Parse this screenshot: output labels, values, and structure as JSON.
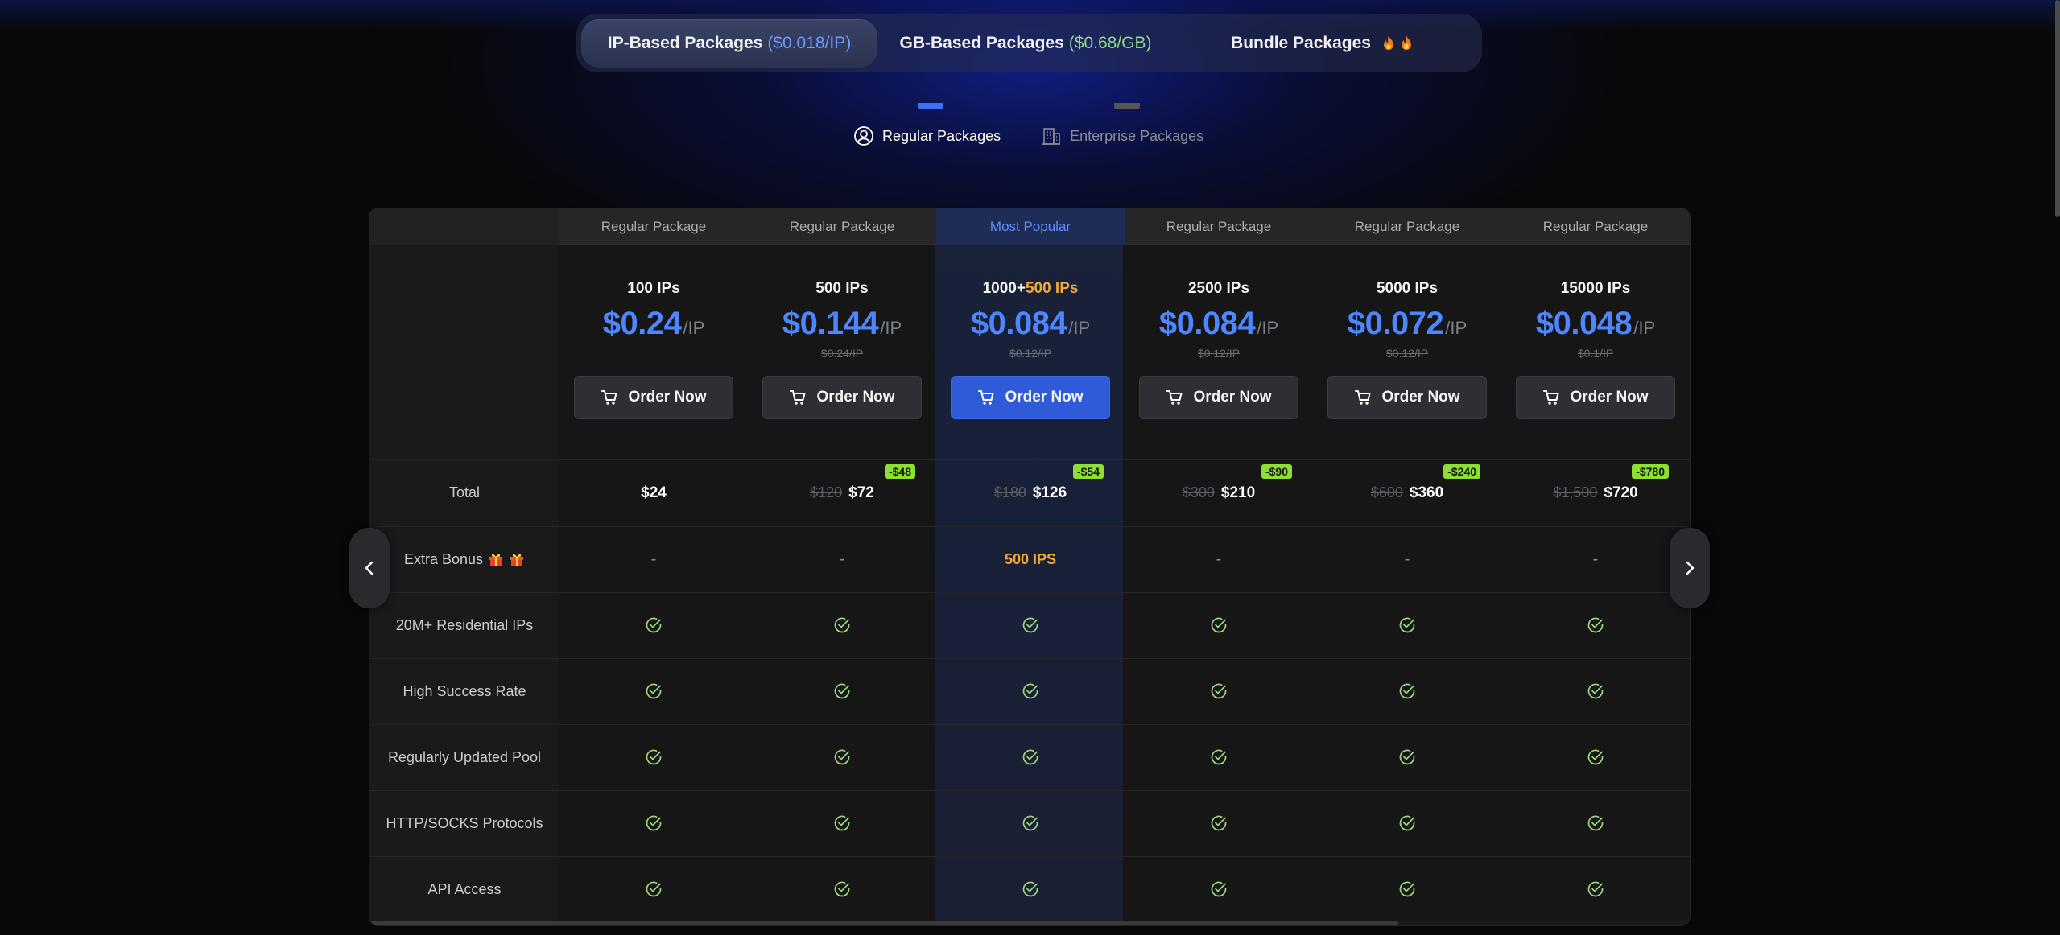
{
  "top_tabs": [
    {
      "label": "IP-Based Packages",
      "rate": "($0.018/IP)",
      "active": true
    },
    {
      "label": "GB-Based Packages",
      "rate": "($0.68/GB)",
      "active": false
    },
    {
      "label": "Bundle Packages",
      "icons": [
        "fire-icon",
        "fire-icon"
      ],
      "active": false
    }
  ],
  "sub_tabs": [
    {
      "label": "Regular Packages",
      "icon": "user-icon",
      "active": true
    },
    {
      "label": "Enterprise Packages",
      "icon": "building-icon",
      "active": false
    }
  ],
  "packages": [
    {
      "header": "Regular Package",
      "ips": "100 IPs",
      "ips_bonus": "",
      "price": "$0.24",
      "unit": "/IP",
      "old_price": "",
      "button": "Order Now",
      "total_old": "",
      "total_new": "$24",
      "save": "",
      "extra_bonus": "-",
      "popular": false
    },
    {
      "header": "Regular Package",
      "ips": "500 IPs",
      "ips_bonus": "",
      "price": "$0.144",
      "unit": "/IP",
      "old_price": "$0.24/IP",
      "button": "Order Now",
      "total_old": "$120",
      "total_new": "$72",
      "save": "-$48",
      "extra_bonus": "-",
      "popular": false
    },
    {
      "header": "Most Popular",
      "ips": "1000+",
      "ips_bonus": "500 IPs",
      "price": "$0.084",
      "unit": "/IP",
      "old_price": "$0.12/IP",
      "button": "Order Now",
      "total_old": "$180",
      "total_new": "$126",
      "save": "-$54",
      "extra_bonus": "500 IPS",
      "popular": true
    },
    {
      "header": "Regular Package",
      "ips": "2500 IPs",
      "ips_bonus": "",
      "price": "$0.084",
      "unit": "/IP",
      "old_price": "$0.12/IP",
      "button": "Order Now",
      "total_old": "$300",
      "total_new": "$210",
      "save": "-$90",
      "extra_bonus": "-",
      "popular": false
    },
    {
      "header": "Regular Package",
      "ips": "5000 IPs",
      "ips_bonus": "",
      "price": "$0.072",
      "unit": "/IP",
      "old_price": "$0.12/IP",
      "button": "Order Now",
      "total_old": "$600",
      "total_new": "$360",
      "save": "-$240",
      "extra_bonus": "-",
      "popular": false
    },
    {
      "header": "Regular Package",
      "ips": "15000 IPs",
      "ips_bonus": "",
      "price": "$0.048",
      "unit": "/IP",
      "old_price": "$0.1/IP",
      "button": "Order Now",
      "total_old": "$1,500",
      "total_new": "$720",
      "save": "-$780",
      "extra_bonus": "-",
      "popular": false
    }
  ],
  "row_labels": {
    "total": "Total",
    "extra_bonus": "Extra Bonus",
    "features": [
      "20M+ Residential IPs",
      "High Success Rate",
      "Regularly Updated Pool",
      "HTTP/SOCKS Protocols",
      "API Access"
    ]
  },
  "colors": {
    "accent_blue": "#4d86ff",
    "popular_button": "#2f5bd8",
    "bonus_orange": "#f1a93a",
    "save_green": "#8ce02e",
    "check_green": "#9ad17a"
  }
}
